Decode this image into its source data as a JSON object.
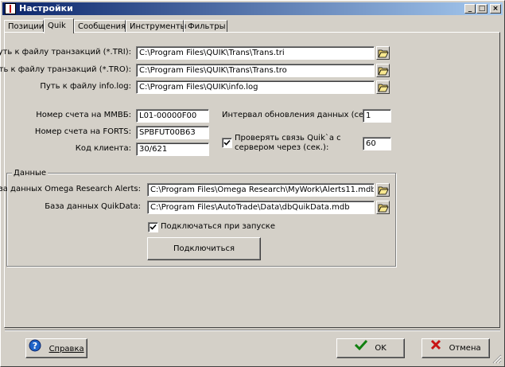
{
  "window": {
    "title": "Настройки",
    "minimize": "_",
    "maximize": "□",
    "close": "×"
  },
  "tabs": [
    {
      "label": "Позиции"
    },
    {
      "label": "Quik"
    },
    {
      "label": "Сообщения"
    },
    {
      "label": "Инструменты"
    },
    {
      "label": "Фильтры"
    }
  ],
  "paths": {
    "tri_label": "Путь к файлу транзакций (*.TRI):",
    "tri_value": "C:\\Program Files\\QUIK\\Trans\\Trans.tri",
    "tro_label": "Путь к файлу транзакций (*.TRO):",
    "tro_value": "C:\\Program Files\\QUIK\\Trans\\Trans.tro",
    "info_label": "Путь к файлу info.log:",
    "info_value": "C:\\Program Files\\QUIK\\info.log"
  },
  "accounts": {
    "micex_label": "Номер счета на ММВБ:",
    "micex_value": "L01-00000F00",
    "forts_label": "Номер счета на FORTS:",
    "forts_value": "SPBFUT00B63",
    "client_label": "Код клиента:",
    "client_value": "30/621"
  },
  "update": {
    "interval_label": "Интервал обновления данных (сек.):",
    "interval_value": "1",
    "check_label_1": "Проверять связь Quik`a с",
    "check_label_2": "сервером через (сек.):",
    "check_checked": true,
    "check_value": "60"
  },
  "data_group": {
    "title": "Данные",
    "omega_label": "База данных Omega Research Alerts:",
    "omega_value": "C:\\Program Files\\Omega Research\\MyWork\\Alerts11.mdb",
    "quikdata_label": "База данных QuikData:",
    "quikdata_value": "C:\\Program Files\\AutoTrade\\Data\\dbQuikData.mdb",
    "autoconnect_label": "Подключаться при запуске",
    "autoconnect_checked": true,
    "connect_button": "Подключиться"
  },
  "footer": {
    "help_button": "Справка",
    "ok_button": "OK",
    "cancel_button": "Отмена"
  },
  "colors": {
    "titlebar_start": "#0a246a",
    "titlebar_end": "#a6caf0",
    "face": "#d4d0c8"
  }
}
